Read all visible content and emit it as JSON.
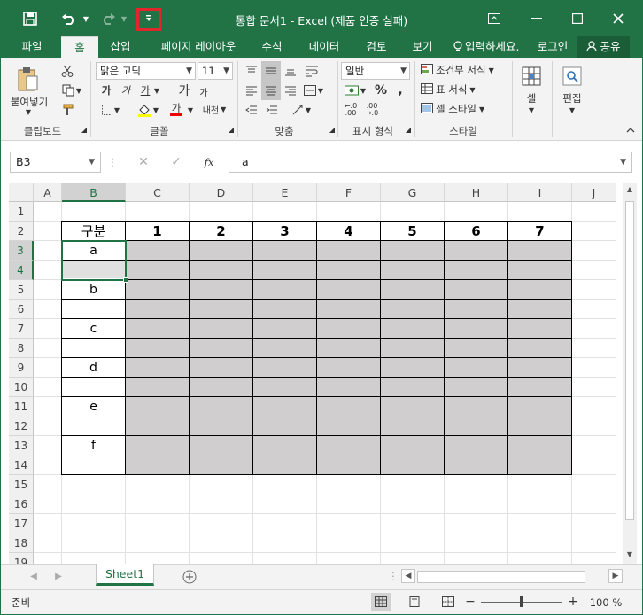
{
  "app": {
    "title": "통합 문서1 - Excel (제품 인증 실패)",
    "colors": {
      "accent": "#217346",
      "highlight": "#e3262b",
      "table_fill": "#d0cece"
    }
  },
  "qat": {
    "save_icon": "save-icon",
    "undo_icon": "undo-icon",
    "redo_icon": "redo-icon",
    "customize_icon": "customize-qat-icon"
  },
  "tabs": [
    {
      "label": "파일"
    },
    {
      "label": "홈"
    },
    {
      "label": "삽입"
    },
    {
      "label": "페이지 레이아웃"
    },
    {
      "label": "수식"
    },
    {
      "label": "데이터"
    },
    {
      "label": "검토"
    },
    {
      "label": "보기"
    }
  ],
  "tellme": "입력하세요.",
  "signin": "로그인",
  "share": "공유",
  "ribbon": {
    "clipboard": {
      "paste": "붙여넣기",
      "label": "클립보드"
    },
    "font": {
      "name": "맑은 고딕",
      "size": "11",
      "label": "글꼴",
      "increase": "가",
      "decrease": "가",
      "bold": "가",
      "italic": "가",
      "underline": "가",
      "fontcolor": "가",
      "phonetic": "내천"
    },
    "alignment": {
      "label": "맞춤"
    },
    "number": {
      "format": "일반",
      "percent": "%",
      "comma": ",",
      "label": "표시 형식",
      "inc": "←.0 .00",
      "dec": ".00 →.0"
    },
    "styles": {
      "conditional": "조건부 서식",
      "table": "표 서식",
      "cell": "셀 스타일",
      "label": "스타일"
    },
    "cells": {
      "label": "셀"
    },
    "editing": {
      "label": "편집"
    }
  },
  "formula_bar": {
    "name_box": "B3",
    "fx": "fx",
    "value": "a"
  },
  "columns": [
    "A",
    "B",
    "C",
    "D",
    "E",
    "F",
    "G",
    "H",
    "I",
    "J"
  ],
  "rows": [
    "1",
    "2",
    "3",
    "4",
    "5",
    "6",
    "7",
    "8",
    "9",
    "10",
    "11",
    "12",
    "13",
    "14",
    "15",
    "16",
    "17",
    "18",
    "19"
  ],
  "table": {
    "header": "구분",
    "numbers": [
      "1",
      "2",
      "3",
      "4",
      "5",
      "6",
      "7"
    ],
    "labels": [
      "a",
      "",
      "b",
      "",
      "c",
      "",
      "d",
      "",
      "e",
      "",
      "f",
      ""
    ]
  },
  "selected_cell": "B3",
  "sheet": {
    "name": "Sheet1"
  },
  "status": {
    "mode": "준비",
    "zoom": "100 %",
    "zoom_percent": 100
  }
}
